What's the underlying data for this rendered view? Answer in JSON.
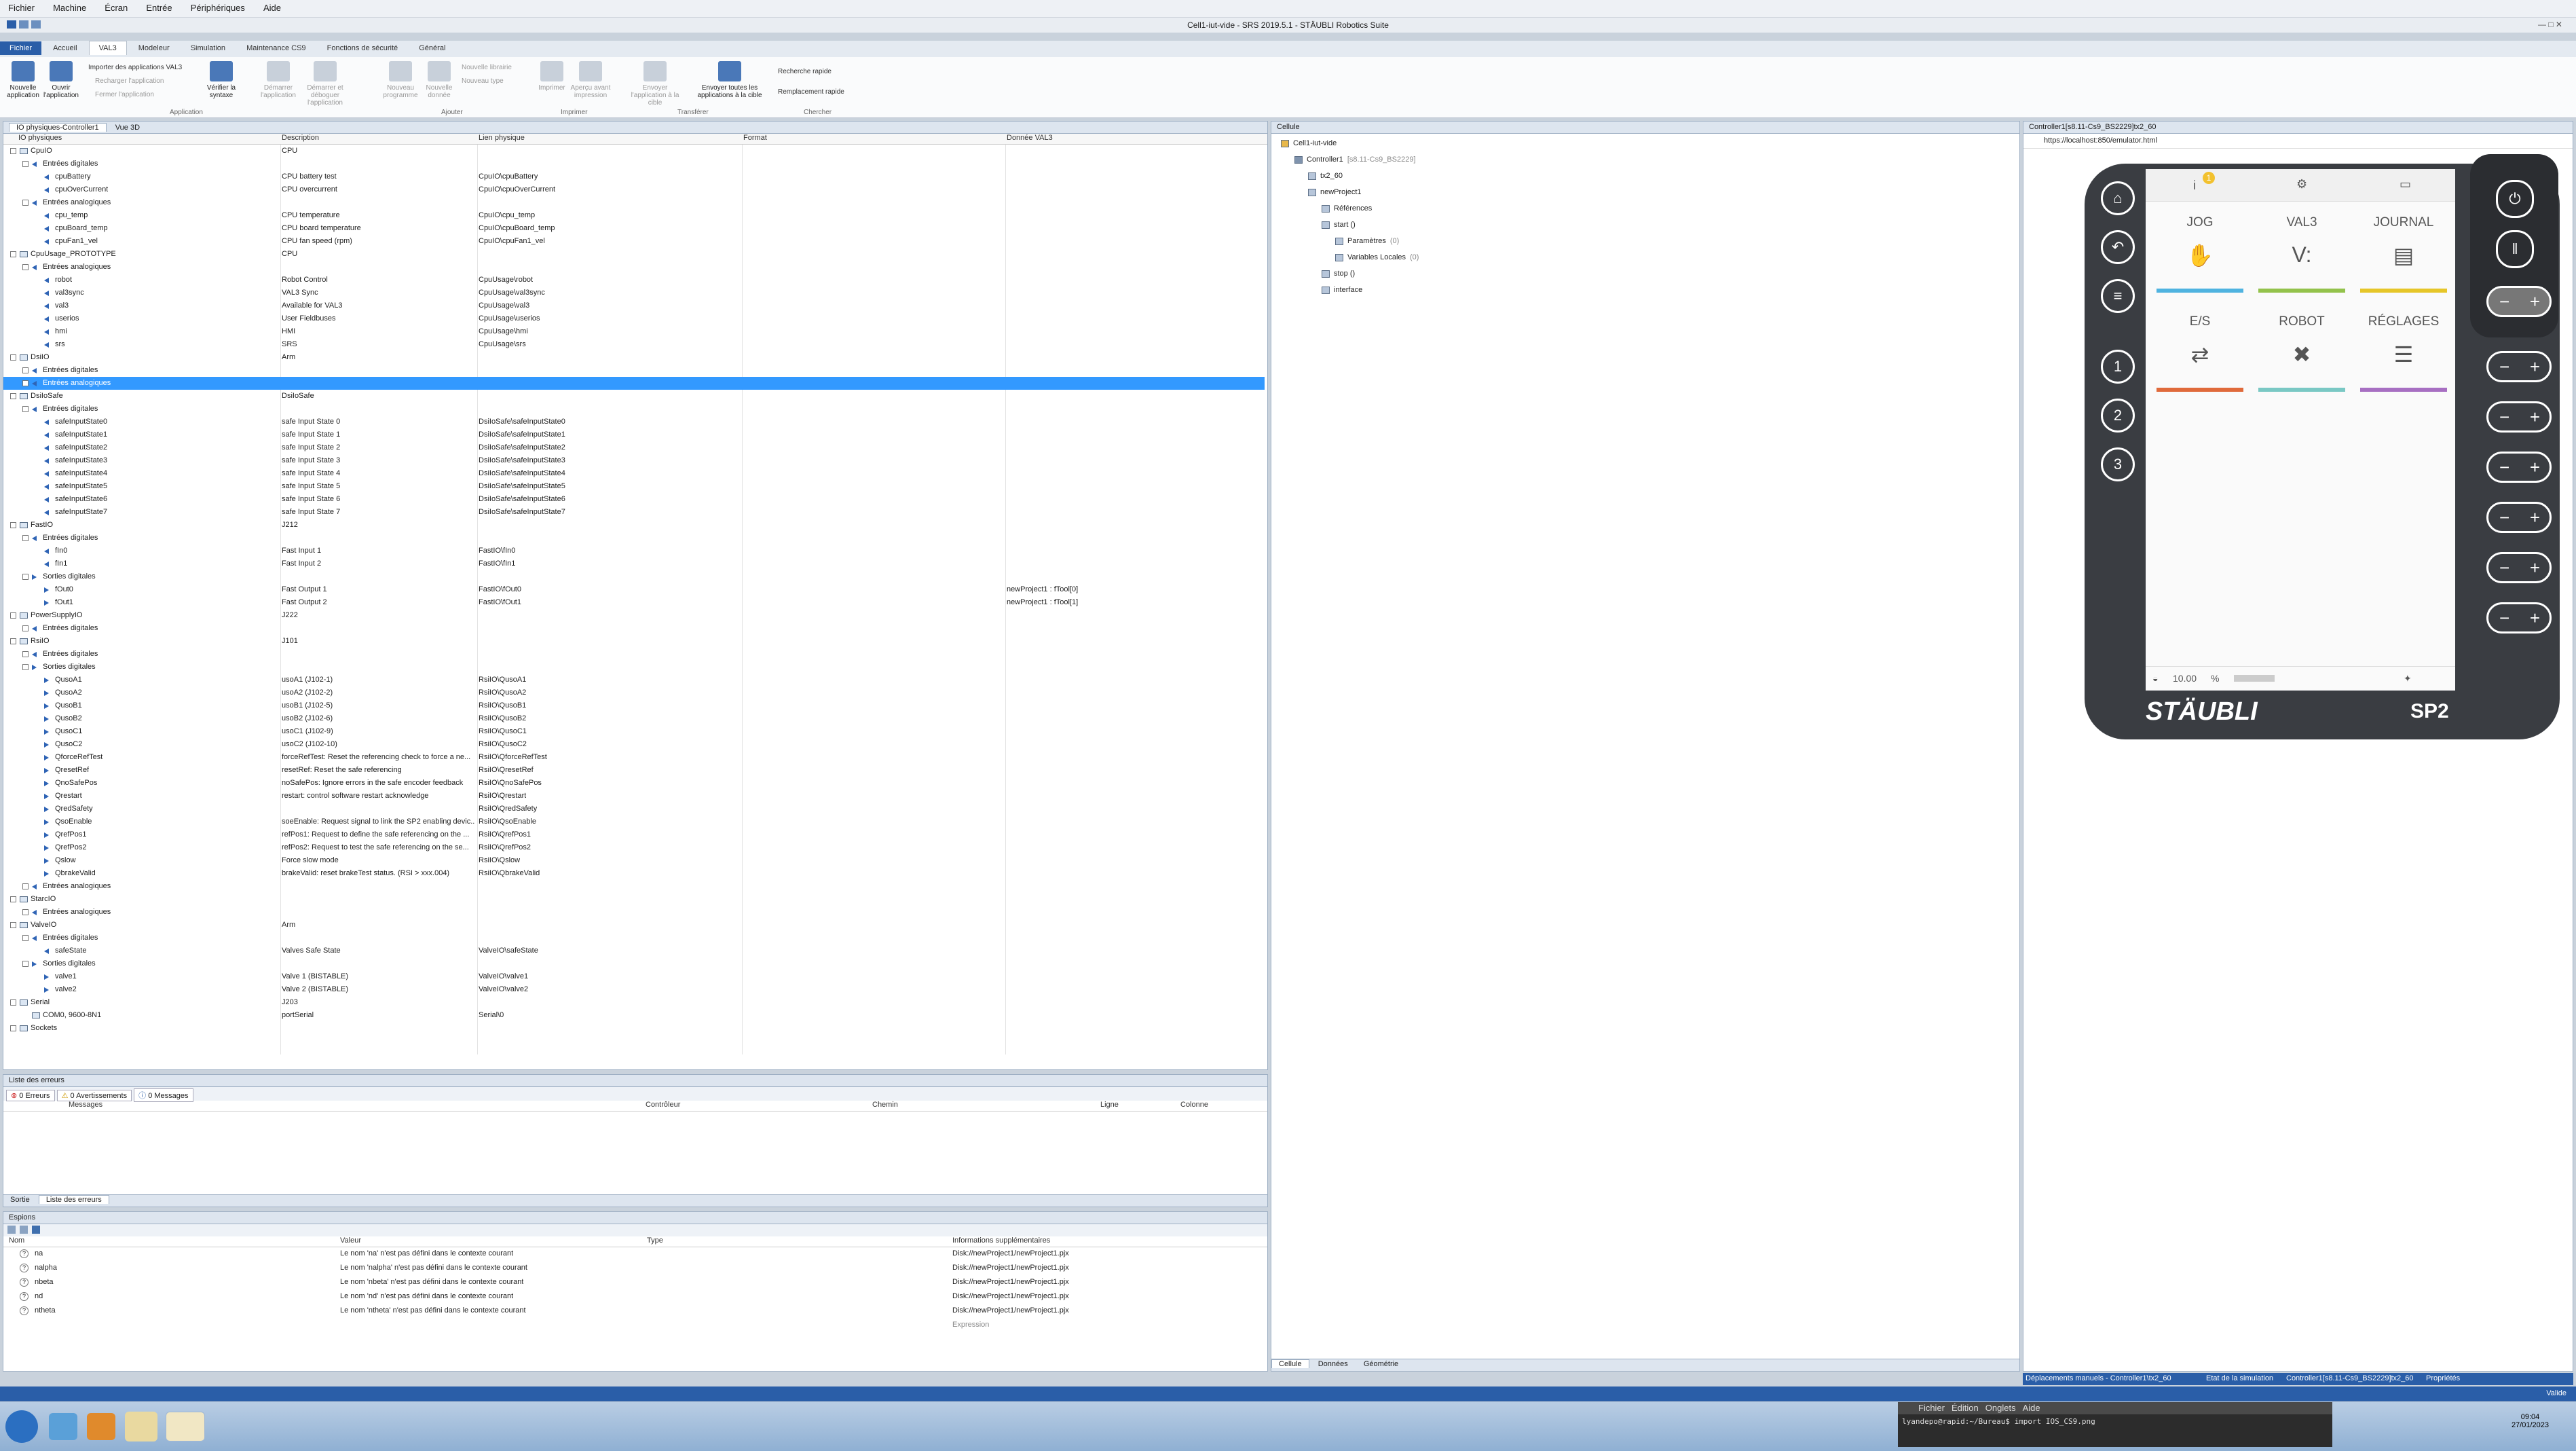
{
  "menu": [
    "Fichier",
    "Machine",
    "Écran",
    "Entrée",
    "Périphériques",
    "Aide"
  ],
  "window_title": "Cell1-iut-vide - SRS 2019.5.1 - STÄUBLI Robotics Suite",
  "ribbon_tabs": [
    "Fichier",
    "Accueil",
    "VAL3",
    "Modeleur",
    "Simulation",
    "Maintenance CS9",
    "Fonctions de sécurité",
    "Général"
  ],
  "ribbon": {
    "new_app": "Nouvelle application",
    "open_app": "Ouvrir l'application",
    "verify": "Vérifier la syntaxe",
    "import": "Importer des applications VAL3",
    "reload": "Recharger l'application",
    "close": "Fermer l'application",
    "start": "Démarrer l'application",
    "start_debug": "Démarrer et déboguer l'application",
    "new_prog": "Nouveau programme",
    "new_data": "Nouvelle donnée",
    "new_lib": "Nouvelle librairie",
    "new_type": "Nouveau type",
    "print": "Imprimer",
    "preview": "Aperçu avant impression",
    "send": "Envoyer l'application à la cible",
    "send_all": "Envoyer toutes les applications à la cible",
    "quick_search": "Recherche rapide",
    "quick_replace": "Remplacement rapide",
    "groups": [
      "Application",
      "Ajouter",
      "Imprimer",
      "Transférer",
      "Chercher"
    ]
  },
  "io_panel": {
    "tabs": [
      "IO physiques-Controller1",
      "Vue 3D"
    ],
    "columns": [
      "IO physiques",
      "Description",
      "Lien physique",
      "Format",
      "Donnée VAL3"
    ],
    "rows": [
      {
        "n": "CpuIO",
        "d": "CPU",
        "l": "",
        "v": "",
        "lvl": 1,
        "t": "g"
      },
      {
        "n": "Entrées digitales",
        "d": "",
        "l": "",
        "v": "",
        "lvl": 2,
        "t": "g"
      },
      {
        "n": "cpuBattery",
        "d": "CPU battery test",
        "l": "CpuIO\\cpuBattery",
        "v": "",
        "lvl": 3,
        "t": "i"
      },
      {
        "n": "cpuOverCurrent",
        "d": "CPU overcurrent",
        "l": "CpuIO\\cpuOverCurrent",
        "v": "",
        "lvl": 3,
        "t": "i"
      },
      {
        "n": "Entrées analogiques",
        "d": "",
        "l": "",
        "v": "",
        "lvl": 2,
        "t": "g"
      },
      {
        "n": "cpu_temp",
        "d": "CPU temperature",
        "l": "CpuIO\\cpu_temp",
        "v": "",
        "lvl": 3,
        "t": "i"
      },
      {
        "n": "cpuBoard_temp",
        "d": "CPU board temperature",
        "l": "CpuIO\\cpuBoard_temp",
        "v": "",
        "lvl": 3,
        "t": "i"
      },
      {
        "n": "cpuFan1_vel",
        "d": "CPU fan speed (rpm)",
        "l": "CpuIO\\cpuFan1_vel",
        "v": "",
        "lvl": 3,
        "t": "i"
      },
      {
        "n": "CpuUsage_PROTOTYPE",
        "d": "CPU",
        "l": "",
        "v": "",
        "lvl": 1,
        "t": "g"
      },
      {
        "n": "Entrées analogiques",
        "d": "",
        "l": "",
        "v": "",
        "lvl": 2,
        "t": "g"
      },
      {
        "n": "robot",
        "d": "Robot Control",
        "l": "CpuUsage\\robot",
        "v": "",
        "lvl": 3,
        "t": "i"
      },
      {
        "n": "val3sync",
        "d": "VAL3 Sync",
        "l": "CpuUsage\\val3sync",
        "v": "",
        "lvl": 3,
        "t": "i"
      },
      {
        "n": "val3",
        "d": "Available for VAL3",
        "l": "CpuUsage\\val3",
        "v": "",
        "lvl": 3,
        "t": "i"
      },
      {
        "n": "userios",
        "d": "User Fieldbuses",
        "l": "CpuUsage\\userios",
        "v": "",
        "lvl": 3,
        "t": "i"
      },
      {
        "n": "hmi",
        "d": "HMI",
        "l": "CpuUsage\\hmi",
        "v": "",
        "lvl": 3,
        "t": "i"
      },
      {
        "n": "srs",
        "d": "SRS",
        "l": "CpuUsage\\srs",
        "v": "",
        "lvl": 3,
        "t": "i"
      },
      {
        "n": "DsiIO",
        "d": "Arm",
        "l": "",
        "v": "",
        "lvl": 1,
        "t": "g"
      },
      {
        "n": "Entrées digitales",
        "d": "",
        "l": "",
        "v": "",
        "lvl": 2,
        "t": "g"
      },
      {
        "n": "Entrées analogiques",
        "d": "",
        "l": "",
        "v": "",
        "lvl": 2,
        "t": "g",
        "sel": true
      },
      {
        "n": "DsiIoSafe",
        "d": "DsiIoSafe",
        "l": "",
        "v": "",
        "lvl": 1,
        "t": "g"
      },
      {
        "n": "Entrées digitales",
        "d": "",
        "l": "",
        "v": "",
        "lvl": 2,
        "t": "g"
      },
      {
        "n": "safeInputState0",
        "d": "safe Input State 0",
        "l": "DsiIoSafe\\safeInputState0",
        "v": "",
        "lvl": 3,
        "t": "i"
      },
      {
        "n": "safeInputState1",
        "d": "safe Input State 1",
        "l": "DsiIoSafe\\safeInputState1",
        "v": "",
        "lvl": 3,
        "t": "i"
      },
      {
        "n": "safeInputState2",
        "d": "safe Input State 2",
        "l": "DsiIoSafe\\safeInputState2",
        "v": "",
        "lvl": 3,
        "t": "i"
      },
      {
        "n": "safeInputState3",
        "d": "safe Input State 3",
        "l": "DsiIoSafe\\safeInputState3",
        "v": "",
        "lvl": 3,
        "t": "i"
      },
      {
        "n": "safeInputState4",
        "d": "safe Input State 4",
        "l": "DsiIoSafe\\safeInputState4",
        "v": "",
        "lvl": 3,
        "t": "i"
      },
      {
        "n": "safeInputState5",
        "d": "safe Input State 5",
        "l": "DsiIoSafe\\safeInputState5",
        "v": "",
        "lvl": 3,
        "t": "i"
      },
      {
        "n": "safeInputState6",
        "d": "safe Input State 6",
        "l": "DsiIoSafe\\safeInputState6",
        "v": "",
        "lvl": 3,
        "t": "i"
      },
      {
        "n": "safeInputState7",
        "d": "safe Input State 7",
        "l": "DsiIoSafe\\safeInputState7",
        "v": "",
        "lvl": 3,
        "t": "i"
      },
      {
        "n": "FastIO",
        "d": "J212",
        "l": "",
        "v": "",
        "lvl": 1,
        "t": "g"
      },
      {
        "n": "Entrées digitales",
        "d": "",
        "l": "",
        "v": "",
        "lvl": 2,
        "t": "g"
      },
      {
        "n": "fIn0",
        "d": "Fast Input 1",
        "l": "FastIO\\fIn0",
        "v": "",
        "lvl": 3,
        "t": "i"
      },
      {
        "n": "fIn1",
        "d": "Fast Input 2",
        "l": "FastIO\\fIn1",
        "v": "",
        "lvl": 3,
        "t": "i"
      },
      {
        "n": "Sorties digitales",
        "d": "",
        "l": "",
        "v": "",
        "lvl": 2,
        "t": "go"
      },
      {
        "n": "fOut0",
        "d": "Fast Output 1",
        "l": "FastIO\\fOut0",
        "v": "newProject1 : fTool[0]",
        "lvl": 3,
        "t": "o"
      },
      {
        "n": "fOut1",
        "d": "Fast Output 2",
        "l": "FastIO\\fOut1",
        "v": "newProject1 : fTool[1]",
        "lvl": 3,
        "t": "o"
      },
      {
        "n": "PowerSupplyIO",
        "d": "J222",
        "l": "",
        "v": "",
        "lvl": 1,
        "t": "g"
      },
      {
        "n": "Entrées digitales",
        "d": "",
        "l": "",
        "v": "",
        "lvl": 2,
        "t": "g"
      },
      {
        "n": "RsiIO",
        "d": "J101",
        "l": "",
        "v": "",
        "lvl": 1,
        "t": "g"
      },
      {
        "n": "Entrées digitales",
        "d": "",
        "l": "",
        "v": "",
        "lvl": 2,
        "t": "g"
      },
      {
        "n": "Sorties digitales",
        "d": "",
        "l": "",
        "v": "",
        "lvl": 2,
        "t": "go"
      },
      {
        "n": "QusoA1",
        "d": "usoA1 (J102-1)",
        "l": "RsiIO\\QusoA1",
        "v": "",
        "lvl": 3,
        "t": "o"
      },
      {
        "n": "QusoA2",
        "d": "usoA2 (J102-2)",
        "l": "RsiIO\\QusoA2",
        "v": "",
        "lvl": 3,
        "t": "o"
      },
      {
        "n": "QusoB1",
        "d": "usoB1 (J102-5)",
        "l": "RsiIO\\QusoB1",
        "v": "",
        "lvl": 3,
        "t": "o"
      },
      {
        "n": "QusoB2",
        "d": "usoB2 (J102-6)",
        "l": "RsiIO\\QusoB2",
        "v": "",
        "lvl": 3,
        "t": "o"
      },
      {
        "n": "QusoC1",
        "d": "usoC1 (J102-9)",
        "l": "RsiIO\\QusoC1",
        "v": "",
        "lvl": 3,
        "t": "o"
      },
      {
        "n": "QusoC2",
        "d": "usoC2 (J102-10)",
        "l": "RsiIO\\QusoC2",
        "v": "",
        "lvl": 3,
        "t": "o"
      },
      {
        "n": "QforceRefTest",
        "d": "forceRefTest: Reset the referencing check to force a ne...",
        "l": "RsiIO\\QforceRefTest",
        "v": "",
        "lvl": 3,
        "t": "o"
      },
      {
        "n": "QresetRef",
        "d": "resetRef: Reset the safe referencing",
        "l": "RsiIO\\QresetRef",
        "v": "",
        "lvl": 3,
        "t": "o"
      },
      {
        "n": "QnoSafePos",
        "d": "noSafePos: Ignore errors in the safe encoder feedback",
        "l": "RsiIO\\QnoSafePos",
        "v": "",
        "lvl": 3,
        "t": "o"
      },
      {
        "n": "Qrestart",
        "d": "restart: control software restart acknowledge",
        "l": "RsiIO\\Qrestart",
        "v": "",
        "lvl": 3,
        "t": "o"
      },
      {
        "n": "QredSafety",
        "d": "",
        "l": "RsiIO\\QredSafety",
        "v": "",
        "lvl": 3,
        "t": "o"
      },
      {
        "n": "QsoEnable",
        "d": "soeEnable: Request signal to link the SP2 enabling devic...",
        "l": "RsiIO\\QsoEnable",
        "v": "",
        "lvl": 3,
        "t": "o"
      },
      {
        "n": "QrefPos1",
        "d": "refPos1: Request to define the safe referencing on the ...",
        "l": "RsiIO\\QrefPos1",
        "v": "",
        "lvl": 3,
        "t": "o"
      },
      {
        "n": "QrefPos2",
        "d": "refPos2: Request to test the safe referencing on the se...",
        "l": "RsiIO\\QrefPos2",
        "v": "",
        "lvl": 3,
        "t": "o"
      },
      {
        "n": "Qslow",
        "d": "Force slow mode",
        "l": "RsiIO\\Qslow",
        "v": "",
        "lvl": 3,
        "t": "o"
      },
      {
        "n": "QbrakeValid",
        "d": "brakeValid: reset brakeTest status. (RSI > xxx.004)",
        "l": "RsiIO\\QbrakeValid",
        "v": "",
        "lvl": 3,
        "t": "o"
      },
      {
        "n": "Entrées analogiques",
        "d": "",
        "l": "",
        "v": "",
        "lvl": 2,
        "t": "g"
      },
      {
        "n": "StarcIO",
        "d": "",
        "l": "",
        "v": "",
        "lvl": 1,
        "t": "g"
      },
      {
        "n": "Entrées analogiques",
        "d": "",
        "l": "",
        "v": "",
        "lvl": 2,
        "t": "g"
      },
      {
        "n": "ValveIO",
        "d": "Arm",
        "l": "",
        "v": "",
        "lvl": 1,
        "t": "g"
      },
      {
        "n": "Entrées digitales",
        "d": "",
        "l": "",
        "v": "",
        "lvl": 2,
        "t": "g"
      },
      {
        "n": "safeState",
        "d": "Valves Safe State",
        "l": "ValveIO\\safeState",
        "v": "",
        "lvl": 3,
        "t": "i"
      },
      {
        "n": "Sorties digitales",
        "d": "",
        "l": "",
        "v": "",
        "lvl": 2,
        "t": "go"
      },
      {
        "n": "valve1",
        "d": "Valve 1 (BISTABLE)",
        "l": "ValveIO\\valve1",
        "v": "",
        "lvl": 3,
        "t": "o"
      },
      {
        "n": "valve2",
        "d": "Valve 2 (BISTABLE)",
        "l": "ValveIO\\valve2",
        "v": "",
        "lvl": 3,
        "t": "o"
      },
      {
        "n": "Serial",
        "d": "J203",
        "l": "",
        "v": "",
        "lvl": 1,
        "t": "g"
      },
      {
        "n": "COM0, 9600-8N1",
        "d": "portSerial",
        "l": "Serial\\0",
        "v": "",
        "lvl": 2,
        "t": "s"
      },
      {
        "n": "Sockets",
        "d": "",
        "l": "",
        "v": "",
        "lvl": 1,
        "t": "g"
      }
    ]
  },
  "errors": {
    "title": "Liste des erreurs",
    "filters": [
      "0 Erreurs",
      "0 Avertissements",
      "0 Messages"
    ],
    "columns": [
      "Messages",
      "Contrôleur",
      "Chemin",
      "Ligne",
      "Colonne"
    ],
    "tabs": [
      "Sortie",
      "Liste des erreurs"
    ]
  },
  "watch": {
    "title": "Espions",
    "columns": [
      "Nom",
      "Valeur",
      "Type",
      "Informations supplémentaires"
    ],
    "rows": [
      {
        "n": "na",
        "v": "Le nom 'na' n'est pas défini dans le contexte courant",
        "i": "Disk://newProject1/newProject1.pjx"
      },
      {
        "n": "nalpha",
        "v": "Le nom 'nalpha' n'est pas défini dans le contexte courant",
        "i": "Disk://newProject1/newProject1.pjx"
      },
      {
        "n": "nbeta",
        "v": "Le nom 'nbeta' n'est pas défini dans le contexte courant",
        "i": "Disk://newProject1/newProject1.pjx"
      },
      {
        "n": "nd",
        "v": "Le nom 'nd' n'est pas défini dans le contexte courant",
        "i": "Disk://newProject1/newProject1.pjx"
      },
      {
        "n": "ntheta",
        "v": "Le nom 'ntheta' n'est pas défini dans le contexte courant",
        "i": "Disk://newProject1/newProject1.pjx"
      }
    ],
    "expression": "Expression"
  },
  "cell": {
    "title": "Cellule",
    "tree": [
      {
        "t": "Cell1-iut-vide",
        "lvl": 0
      },
      {
        "t": "Controller1",
        "extra": "[s8.11-Cs9_BS2229]",
        "lvl": 1
      },
      {
        "t": "tx2_60",
        "lvl": 2
      },
      {
        "t": "newProject1",
        "lvl": 2
      },
      {
        "t": "Références",
        "lvl": 3
      },
      {
        "t": "start ()",
        "lvl": 3
      },
      {
        "t": "Paramètres",
        "extra": "(0)",
        "lvl": 4
      },
      {
        "t": "Variables Locales",
        "extra": "(0)",
        "lvl": 4
      },
      {
        "t": "stop ()",
        "lvl": 3
      },
      {
        "t": "interface",
        "lvl": 3
      }
    ],
    "bottom_tabs": [
      "Cellule",
      "Données",
      "Géométrie"
    ]
  },
  "pendant": {
    "title": "Controller1[s8.11-Cs9_BS2229]tx2_60",
    "url": "https://localhost:850/emulator.html",
    "tiles": [
      {
        "label": "JOG",
        "glyph": "✋",
        "color": "#4fb3e0"
      },
      {
        "label": "VAL3",
        "glyph": "V:",
        "color": "#93c24b"
      },
      {
        "label": "JOURNAL",
        "glyph": "▤",
        "color": "#e6c629"
      },
      {
        "label": "E/S",
        "glyph": "⇄",
        "color": "#e06a3b"
      },
      {
        "label": "ROBOT",
        "glyph": "✖",
        "color": "#7ac8c4"
      },
      {
        "label": "RÉGLAGES",
        "glyph": "☰",
        "color": "#a76fc2"
      }
    ],
    "badge": "1",
    "speed": "10.00",
    "speed_unit": "%",
    "numbers": [
      "1",
      "2",
      "3"
    ],
    "brand": "STÄUBLI",
    "model": "SP2"
  },
  "status": {
    "items": [
      "Déplacements manuels - Controller1\\tx2_60",
      "Etat de la simulation",
      "Controller1[s8.11-Cs9_BS2229]tx2_60",
      "Propriétés"
    ],
    "right": "Valide"
  },
  "terminal": {
    "menu": [
      "Fichier",
      "Édition",
      "Onglets",
      "Aide"
    ],
    "prompt": "lyandepo@rapid:~/Bureau$ import IOS_CS9.png"
  },
  "clock": {
    "time": "09:04",
    "date": "27/01/2023"
  },
  "colors": {
    "accent": "#2a5ea8",
    "selection": "#3399ff",
    "pendant_body": "#3a3d42"
  }
}
